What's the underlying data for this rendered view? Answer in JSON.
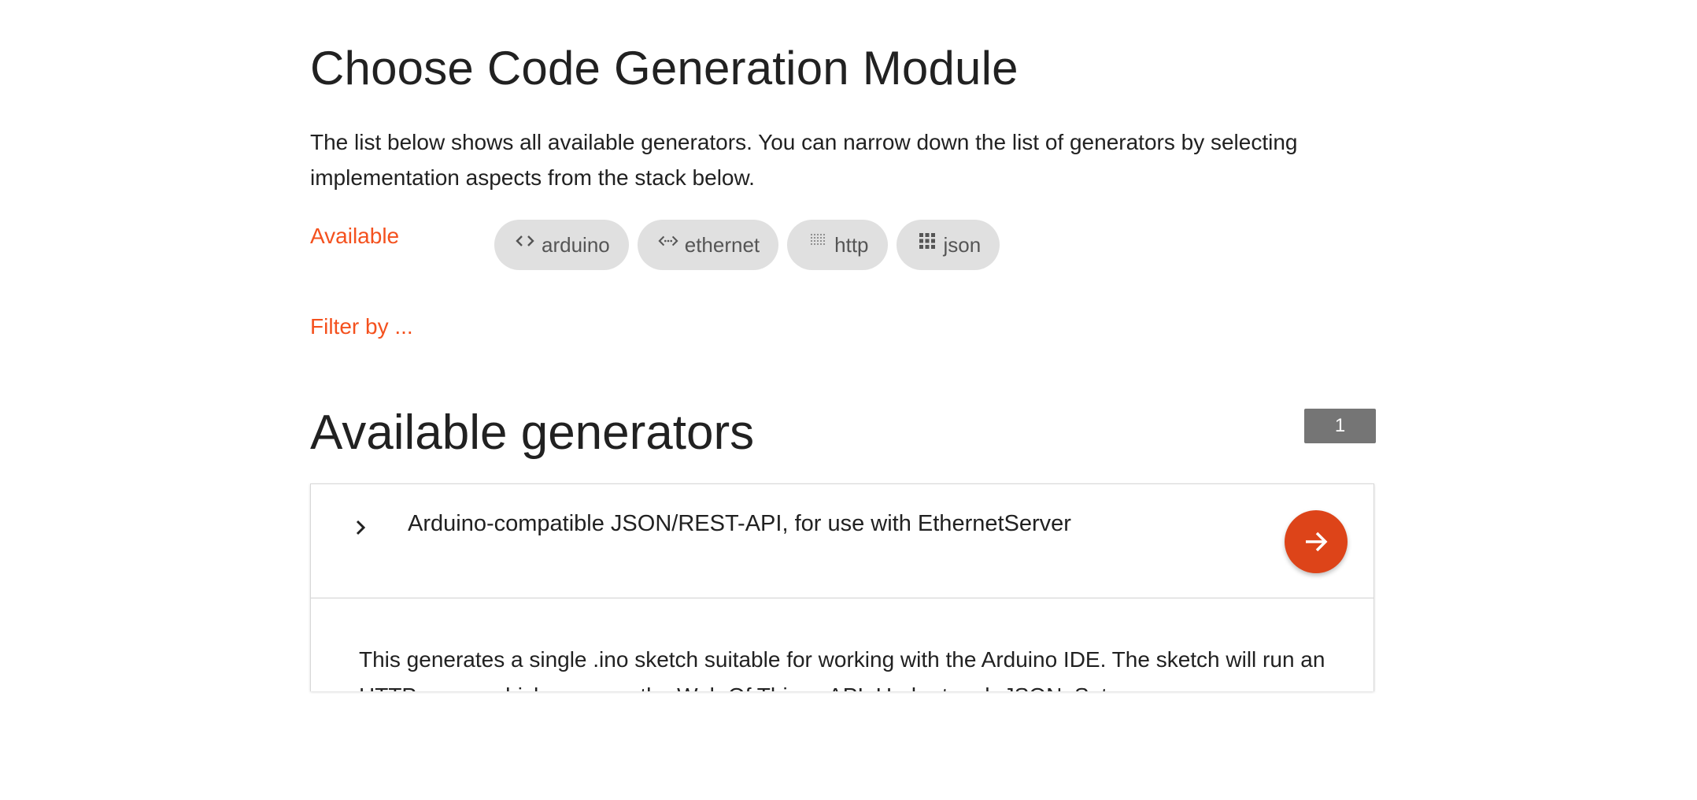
{
  "header": {
    "title": "Choose Code Generation Module",
    "intro": "The list below shows all available generators. You can narrow down the list of generators by selecting implementation aspects from the stack below."
  },
  "filters": {
    "available_label": "Available",
    "filter_label": "Filter by ...",
    "chips": [
      {
        "label": "arduino",
        "icon": "code-icon"
      },
      {
        "label": "ethernet",
        "icon": "settings-ethernet-icon"
      },
      {
        "label": "http",
        "icon": "grid-dots-icon"
      },
      {
        "label": "json",
        "icon": "apps-grid-icon"
      }
    ]
  },
  "generators": {
    "section_title": "Available generators",
    "count": "1",
    "items": [
      {
        "title": "Arduino-compatible JSON/REST-API, for use with EthernetServer",
        "description": "This generates a single .ino sketch suitable for working with the Arduino IDE. The sketch will run an HTTP server which exposes the Web Of Things API. Under tough JSON. Set"
      }
    ]
  },
  "colors": {
    "accent": "#f4511e",
    "go_button": "#dd4419",
    "chip_bg": "#e0e0e0",
    "badge_bg": "#757575"
  }
}
